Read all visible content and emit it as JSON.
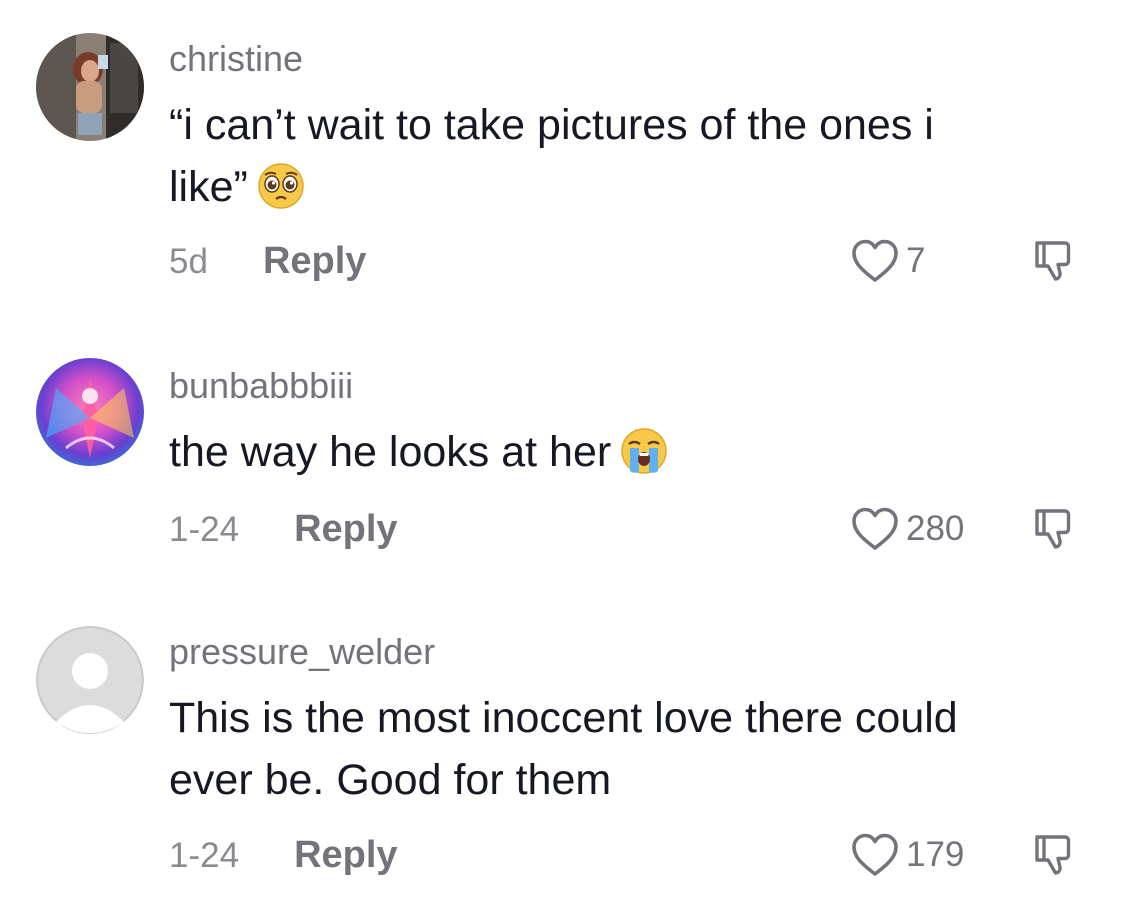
{
  "comments": [
    {
      "username": "christine",
      "text_line1": "“i can’t wait to take pictures of the ones i",
      "text_line2": "like”",
      "emoji": "pleading-face-emoji",
      "date": "5d",
      "reply_label": "Reply",
      "likes": "7",
      "avatar": "photo-avatar"
    },
    {
      "username": "bunbabbbiii",
      "text": "the way he looks at her",
      "emoji": "loudly-crying-face-emoji",
      "date": "1-24",
      "reply_label": "Reply",
      "likes": "280",
      "avatar": "colorful-art-avatar"
    },
    {
      "username": "pressure_welder",
      "text_line1": "This is the most inoccent love there could",
      "text_line2": "ever be. Good for them",
      "date": "1-24",
      "reply_label": "Reply",
      "likes": "179",
      "avatar": "default-avatar"
    }
  ],
  "icons": {
    "like": "heart-outline-icon",
    "dislike": "thumbs-down-outline-icon"
  },
  "colors": {
    "text": "#161823",
    "username": "#73747b",
    "meta": "#8a8b91"
  }
}
